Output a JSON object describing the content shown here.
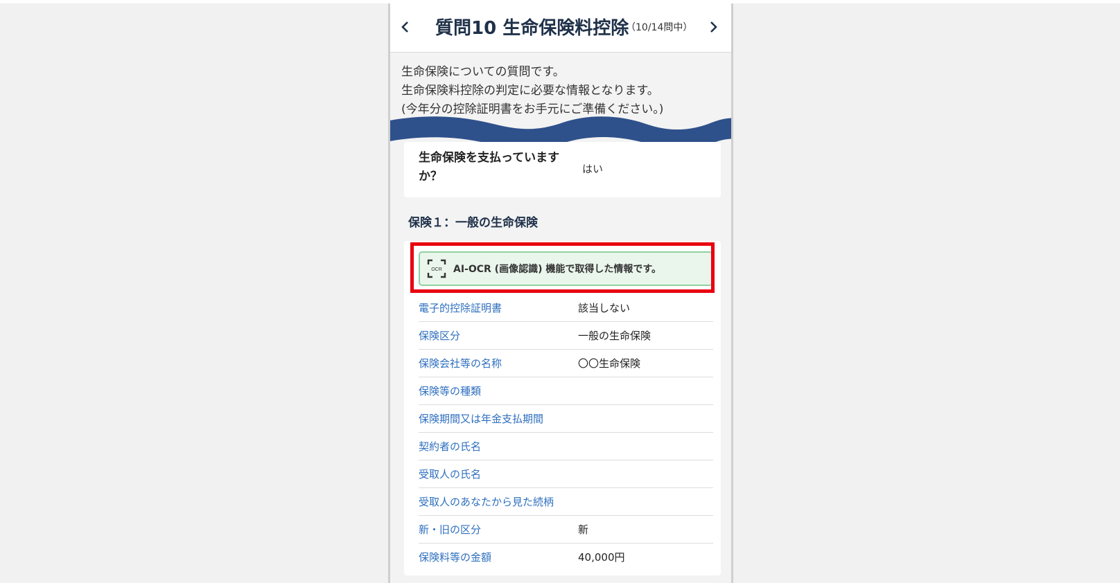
{
  "header": {
    "title": "質問10 生命保険料控除",
    "counter": "（10/14問中）"
  },
  "intro": {
    "line1": "生命保険についての質問です。",
    "line2": "生命保険料控除の判定に必要な情報となります。",
    "line3": "(今年分の控除証明書をお手元にご準備ください。)"
  },
  "question": {
    "label": "生命保険を支払っていますか？",
    "answer": "はい"
  },
  "section": {
    "title": "保険１：一般の生命保険"
  },
  "ocr": {
    "icon_text": "OCR",
    "message": "AI-OCR (画像認識) 機能で取得した情報です。"
  },
  "details": [
    {
      "label": "電子的控除証明書",
      "value": "該当しない"
    },
    {
      "label": "保険区分",
      "value": "一般の生命保険"
    },
    {
      "label": "保険会社等の名称",
      "value": "〇〇生命保険"
    },
    {
      "label": "保険等の種類",
      "value": ""
    },
    {
      "label": "保険期間又は年金支払期間",
      "value": ""
    },
    {
      "label": "契約者の氏名",
      "value": ""
    },
    {
      "label": "受取人の氏名",
      "value": ""
    },
    {
      "label": "受取人のあなたから見た続柄",
      "value": ""
    },
    {
      "label": "新・旧の区分",
      "value": "新"
    },
    {
      "label": "保険料等の金額",
      "value": "40,000円"
    }
  ],
  "colors": {
    "accent_blue": "#2e6fbf",
    "wave": "#2f518b",
    "highlight_red": "#e8000f",
    "ocr_green_bg": "#eaf6ec"
  },
  "icons": {
    "prev": "chevron-left-icon",
    "next": "chevron-right-icon",
    "ocr": "ocr-scan-icon"
  }
}
